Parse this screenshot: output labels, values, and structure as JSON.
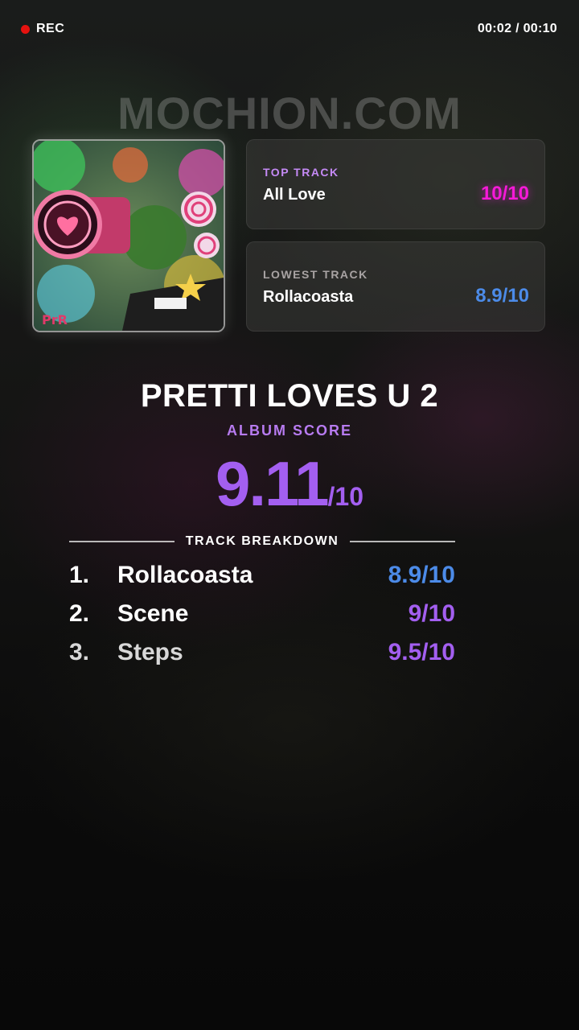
{
  "recording": {
    "label": "REC",
    "timer": "00:02 / 00:10"
  },
  "watermark": "MOCHION.COM",
  "top_track": {
    "label": "TOP TRACK",
    "name": "All Love",
    "score": "10/10"
  },
  "lowest_track": {
    "label": "LOWEST TRACK",
    "name": "Rollacoasta",
    "score": "8.9/10"
  },
  "album": {
    "title": "PRETTI LOVES U 2",
    "score_label": "ALBUM SCORE",
    "score": "9.11",
    "score_suffix": "/10"
  },
  "breakdown_label": "TRACK BREAKDOWN",
  "tracks": [
    {
      "num": "1.",
      "name": "Rollacoasta",
      "score": "8.9/10",
      "color": "#4c8be8"
    },
    {
      "num": "2.",
      "name": "Scene",
      "score": "9/10",
      "color": "#a35ff0"
    },
    {
      "num": "3.",
      "name": "Steps",
      "score": "9.5/10",
      "color": "#a35ff0"
    }
  ],
  "colors": {
    "accent_purple": "#a35ff0",
    "accent_pink": "#f51ad8",
    "accent_blue": "#4c8be8",
    "rec_red": "#e5120f"
  }
}
